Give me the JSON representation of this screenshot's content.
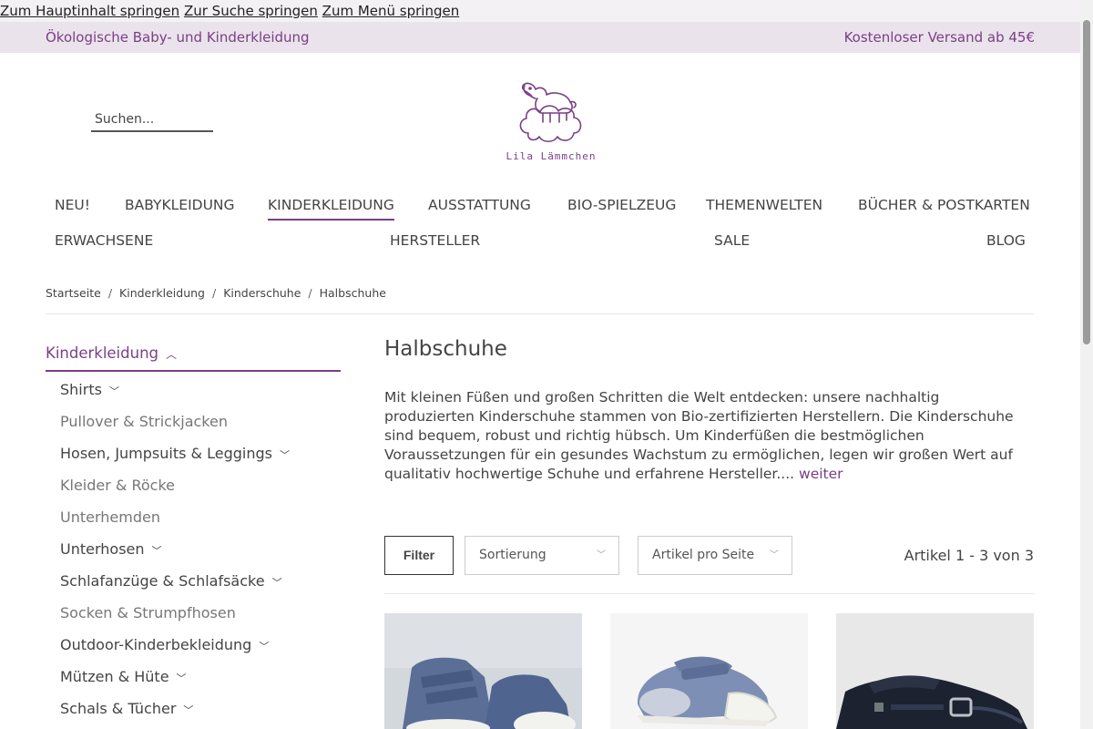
{
  "skip_links": [
    "Zum Hauptinhalt springen",
    "Zur Suche springen",
    "Zum Menü springen"
  ],
  "topbar": {
    "left": "Ökologische Baby- und Kinderkleidung",
    "right": "Kostenloser Versand ab 45€"
  },
  "search": {
    "placeholder": "Suchen..."
  },
  "logo": {
    "text": "Lila Lämmchen"
  },
  "nav": {
    "row1": [
      "NEU!",
      "BABYKLEIDUNG",
      "KINDERKLEIDUNG",
      "AUSSTATTUNG",
      "BIO-SPIELZEUG",
      "THEMENWELTEN",
      "BÜCHER & POSTKARTEN"
    ],
    "row2": [
      "ERWACHSENE",
      "HERSTELLER",
      "SALE",
      "BLOG"
    ],
    "active": "KINDERKLEIDUNG"
  },
  "breadcrumb": [
    "Startseite",
    "Kinderkleidung",
    "Kinderschuhe",
    "Halbschuhe"
  ],
  "sidebar": {
    "heading": "Kinderkleidung",
    "items": [
      {
        "label": "Shirts",
        "expandable": true
      },
      {
        "label": "Pullover & Strickjacken",
        "expandable": false
      },
      {
        "label": "Hosen, Jumpsuits & Leggings",
        "expandable": true
      },
      {
        "label": "Kleider & Röcke",
        "expandable": false
      },
      {
        "label": "Unterhemden",
        "expandable": false
      },
      {
        "label": "Unterhosen",
        "expandable": true
      },
      {
        "label": "Schlafanzüge & Schlafsäcke",
        "expandable": true
      },
      {
        "label": "Socken & Strumpfhosen",
        "expandable": false
      },
      {
        "label": "Outdoor-Kinderbekleidung",
        "expandable": true
      },
      {
        "label": "Mützen & Hüte",
        "expandable": true
      },
      {
        "label": "Schals & Tücher",
        "expandable": true
      }
    ]
  },
  "main": {
    "title": "Halbschuhe",
    "description": "Mit kleinen Füßen und großen Schritten die Welt entdecken: unsere nachhaltig produzierten Kinderschuhe stammen von Bio-zertifizierten Herstellern. Die Kinderschuhe sind bequem, robust und richtig hübsch. Um Kinderfüßen die bestmöglichen Voraussetzungen für ein gesundes Wachstum zu ermöglichen, legen wir großen Wert auf qualitativ hochwertige Schuhe und erfahrene Hersteller....",
    "more_link": "weiter"
  },
  "toolbar": {
    "filter": "Filter",
    "sort_placeholder": "Sortierung",
    "per_page_placeholder": "Artikel pro Seite",
    "count": "Artikel 1 - 3 von 3"
  },
  "colors": {
    "accent": "#7a3f86",
    "topbar_bg": "#ebe3ec"
  }
}
